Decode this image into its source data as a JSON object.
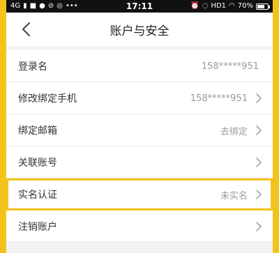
{
  "status_bar": {
    "network": "4G",
    "time": "17:11",
    "hd_label": "HD1",
    "battery": "70%",
    "battery_level": 0.7
  },
  "nav": {
    "title": "账户与安全",
    "back_icon": "chevron-left-icon"
  },
  "rows": [
    {
      "label": "登录名",
      "value": "158*****951",
      "chevron": false
    },
    {
      "label": "修改绑定手机",
      "value": "158*****951",
      "chevron": true
    },
    {
      "label": "绑定邮箱",
      "value": "去绑定",
      "chevron": true
    },
    {
      "label": "关联账号",
      "value": "",
      "chevron": true
    },
    {
      "label": "实名认证",
      "value": "未实名",
      "chevron": true,
      "highlighted": true
    },
    {
      "label": "注销账户",
      "value": "",
      "chevron": true
    }
  ],
  "colors": {
    "accent": "#f4c31b",
    "value_text": "#9a9a9a",
    "background": "#f3f3f3"
  }
}
